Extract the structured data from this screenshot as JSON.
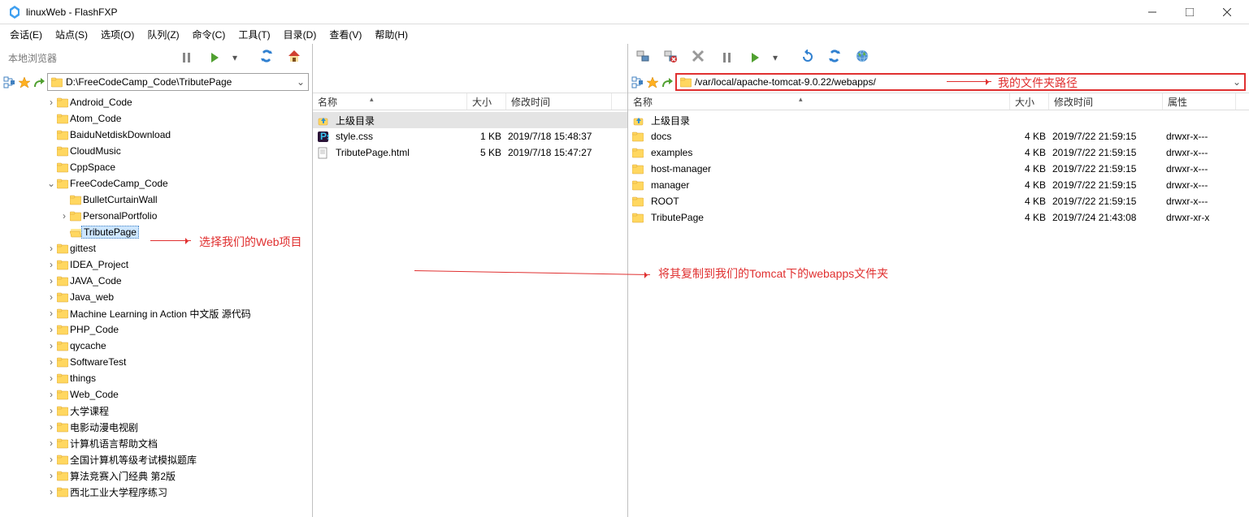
{
  "window": {
    "title": "linuxWeb - FlashFXP"
  },
  "menu": {
    "items": [
      {
        "label": "会话(E)"
      },
      {
        "label": "站点(S)"
      },
      {
        "label": "选项(O)"
      },
      {
        "label": "队列(Z)"
      },
      {
        "label": "命令(C)"
      },
      {
        "label": "工具(T)"
      },
      {
        "label": "目录(D)"
      },
      {
        "label": "查看(V)"
      },
      {
        "label": "帮助(H)"
      }
    ]
  },
  "pane_a": {
    "browser_label": "本地浏览器",
    "path": "D:\\FreeCodeCamp_Code\\TributePage",
    "tree": [
      {
        "label": "Android_Code",
        "depth": 3,
        "exp": ">"
      },
      {
        "label": "Atom_Code",
        "depth": 3,
        "exp": ""
      },
      {
        "label": "BaiduNetdiskDownload",
        "depth": 3,
        "exp": ""
      },
      {
        "label": "CloudMusic",
        "depth": 3,
        "exp": ""
      },
      {
        "label": "CppSpace",
        "depth": 3,
        "exp": ""
      },
      {
        "label": "FreeCodeCamp_Code",
        "depth": 3,
        "exp": "v"
      },
      {
        "label": "BulletCurtainWall",
        "depth": 4,
        "exp": ""
      },
      {
        "label": "PersonalPortfolio",
        "depth": 4,
        "exp": ">"
      },
      {
        "label": "TributePage",
        "depth": 4,
        "exp": "",
        "sel": true
      },
      {
        "label": "gittest",
        "depth": 3,
        "exp": ">"
      },
      {
        "label": "IDEA_Project",
        "depth": 3,
        "exp": ">"
      },
      {
        "label": "JAVA_Code",
        "depth": 3,
        "exp": ">"
      },
      {
        "label": "Java_web",
        "depth": 3,
        "exp": ">"
      },
      {
        "label": "Machine Learning in Action 中文版 源代码",
        "depth": 3,
        "exp": ">"
      },
      {
        "label": "PHP_Code",
        "depth": 3,
        "exp": ">"
      },
      {
        "label": "qycache",
        "depth": 3,
        "exp": ">"
      },
      {
        "label": "SoftwareTest",
        "depth": 3,
        "exp": ">"
      },
      {
        "label": "things",
        "depth": 3,
        "exp": ">"
      },
      {
        "label": "Web_Code",
        "depth": 3,
        "exp": ">"
      },
      {
        "label": "大学课程",
        "depth": 3,
        "exp": ">"
      },
      {
        "label": "电影动漫电视剧",
        "depth": 3,
        "exp": ">"
      },
      {
        "label": "计算机语言帮助文档",
        "depth": 3,
        "exp": ">"
      },
      {
        "label": "全国计算机等级考试模拟题库",
        "depth": 3,
        "exp": ">"
      },
      {
        "label": "算法竞赛入门经典 第2版",
        "depth": 3,
        "exp": ">"
      },
      {
        "label": "西北工业大学程序练习",
        "depth": 3,
        "exp": ">"
      }
    ]
  },
  "pane_b": {
    "headers": {
      "name": "名称",
      "size": "大小",
      "modified": "修改时间"
    },
    "updir_label": "上级目录",
    "files": [
      {
        "name": "style.css",
        "icon": "ps",
        "size": "1 KB",
        "modified": "2019/7/18 15:48:37"
      },
      {
        "name": "TributePage.html",
        "icon": "file",
        "size": "5 KB",
        "modified": "2019/7/18 15:47:27"
      }
    ]
  },
  "pane_c": {
    "path": "/var/local/apache-tomcat-9.0.22/webapps/",
    "headers": {
      "name": "名称",
      "size": "大小",
      "modified": "修改时间",
      "attrs": "属性"
    },
    "updir_label": "上级目录",
    "files": [
      {
        "name": "docs",
        "size": "4 KB",
        "modified": "2019/7/22 21:59:15",
        "attrs": "drwxr-x---"
      },
      {
        "name": "examples",
        "size": "4 KB",
        "modified": "2019/7/22 21:59:15",
        "attrs": "drwxr-x---"
      },
      {
        "name": "host-manager",
        "size": "4 KB",
        "modified": "2019/7/22 21:59:15",
        "attrs": "drwxr-x---"
      },
      {
        "name": "manager",
        "size": "4 KB",
        "modified": "2019/7/22 21:59:15",
        "attrs": "drwxr-x---"
      },
      {
        "name": "ROOT",
        "size": "4 KB",
        "modified": "2019/7/22 21:59:15",
        "attrs": "drwxr-x---"
      },
      {
        "name": "TributePage",
        "size": "4 KB",
        "modified": "2019/7/24 21:43:08",
        "attrs": "drwxr-xr-x"
      }
    ]
  },
  "annotations": {
    "a1": "选择我们的Web项目",
    "a2": "将其复制到我们的Tomcat下的webapps文件夹",
    "a3": "我的文件夹路径"
  }
}
